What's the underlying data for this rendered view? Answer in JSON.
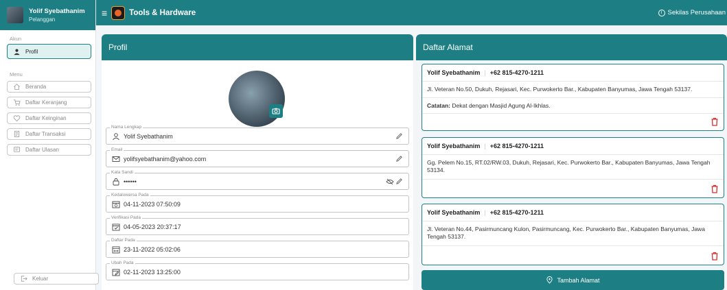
{
  "sidebar": {
    "user": {
      "name": "Yolif Syebathanim",
      "role": "Pelanggan"
    },
    "section_account": "Akun",
    "profile_label": "Profil",
    "section_menu": "Menu",
    "items": [
      {
        "label": "Beranda",
        "icon": "home-icon"
      },
      {
        "label": "Daftar Keranjang",
        "icon": "cart-icon"
      },
      {
        "label": "Daftar Keinginan",
        "icon": "heart-icon"
      },
      {
        "label": "Daftar Transaksi",
        "icon": "receipt-icon"
      },
      {
        "label": "Daftar Ulasan",
        "icon": "review-icon"
      }
    ],
    "logout_label": "Keluar"
  },
  "header": {
    "brand": "Tools & Hardware",
    "right_link": "Sekilas Perusahaan"
  },
  "profile": {
    "title": "Profil",
    "fields": [
      {
        "label": "Nama Lengkap",
        "value": "Yolif Syebathanim"
      },
      {
        "label": "Email",
        "value": "yolifsyebathanim@yahoo.com"
      },
      {
        "label": "Kata Sandi",
        "value": "••••••"
      },
      {
        "label": "Kedaluwarsa Pada",
        "value": "04-11-2023 07:50:09"
      },
      {
        "label": "Verifikasi Pada",
        "value": "04-05-2023 20:37:17"
      },
      {
        "label": "Daftar Pada",
        "value": "23-11-2022 05:02:06"
      },
      {
        "label": "Ubah Pada",
        "value": "02-11-2023 13:25:00"
      }
    ]
  },
  "addresses": {
    "title": "Daftar Alamat",
    "list": [
      {
        "name": "Yolif Syebathanim",
        "phone": "+62 815-4270-1211",
        "address": "Jl. Veteran No.50, Dukuh, Rejasari, Kec. Purwokerto Bar., Kabupaten Banyumas, Jawa Tengah 53137.",
        "note_label": "Catatan:",
        "note": "Dekat dengan Masjid Agung Al-Ikhlas."
      },
      {
        "name": "Yolif Syebathanim",
        "phone": "+62 815-4270-1211",
        "address": "Gg. Pelem No.15, RT.02/RW.03, Dukuh, Rejasari, Kec. Purwokerto Bar., Kabupaten Banyumas, Jawa Tengah 53134."
      },
      {
        "name": "Yolif Syebathanim",
        "phone": "+62 815-4270-1211",
        "address": "Jl. Veteran No.44, Pasirmuncang Kulon, Pasirmuncang, Kec. Purwokerto Bar., Kabupaten Banyumas, Jawa Tengah 53137."
      }
    ],
    "add_label": "Tambah Alamat"
  },
  "colors": {
    "primary": "#1d7f84",
    "danger": "#d32f2f"
  }
}
